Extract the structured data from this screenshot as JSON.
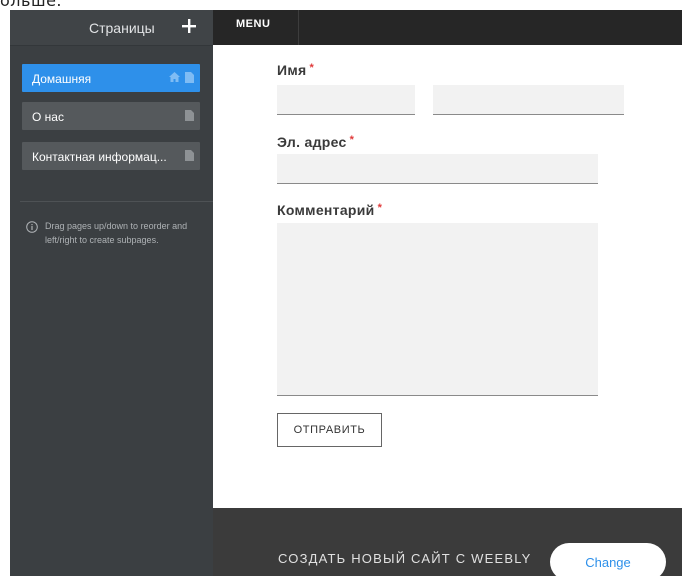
{
  "page": {
    "top_cutoff_text": "ольше."
  },
  "sidebar": {
    "title": "Страницы",
    "pages": [
      {
        "label": "Домашняя",
        "active": true,
        "icons": [
          "home-icon",
          "page-icon"
        ]
      },
      {
        "label": "О нас",
        "active": false,
        "icons": [
          "page-icon"
        ]
      },
      {
        "label": "Контактная информац...",
        "active": false,
        "icons": [
          "page-icon"
        ]
      }
    ],
    "hint": "Drag pages up/down to reorder and left/right to create subpages."
  },
  "menubar": {
    "label": "MENU"
  },
  "form": {
    "name_label": "Имя",
    "email_label": "Эл. адрес",
    "comment_label": "Комментарий",
    "required_marker": "*",
    "submit_label": "ОТПРАВИТЬ"
  },
  "footer": {
    "text": "СОЗДАТЬ НОВЫЙ САЙТ С WEEBLY",
    "change_label": "Change"
  },
  "colors": {
    "accent": "#2e90ea",
    "required": "#e03a3a",
    "sidebar_bg": "#3b3f42",
    "menubar_bg": "#262626",
    "footer_bg": "#3b3b3b"
  }
}
